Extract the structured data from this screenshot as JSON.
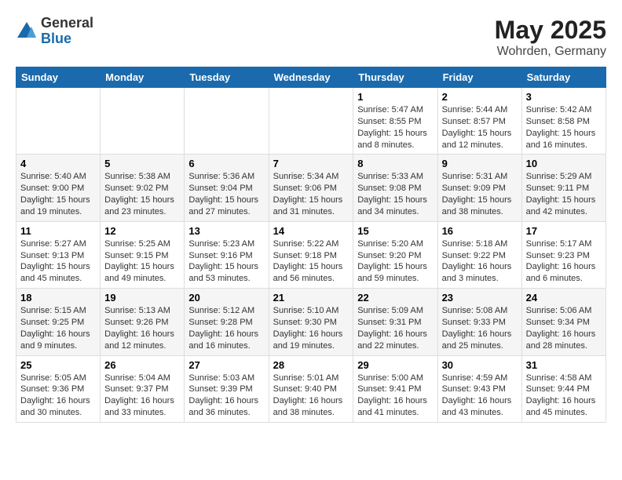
{
  "logo": {
    "general": "General",
    "blue": "Blue"
  },
  "header": {
    "month_year": "May 2025",
    "location": "Wohrden, Germany"
  },
  "weekdays": [
    "Sunday",
    "Monday",
    "Tuesday",
    "Wednesday",
    "Thursday",
    "Friday",
    "Saturday"
  ],
  "weeks": [
    [
      {
        "day": "",
        "info": ""
      },
      {
        "day": "",
        "info": ""
      },
      {
        "day": "",
        "info": ""
      },
      {
        "day": "",
        "info": ""
      },
      {
        "day": "1",
        "info": "Sunrise: 5:47 AM\nSunset: 8:55 PM\nDaylight: 15 hours\nand 8 minutes."
      },
      {
        "day": "2",
        "info": "Sunrise: 5:44 AM\nSunset: 8:57 PM\nDaylight: 15 hours\nand 12 minutes."
      },
      {
        "day": "3",
        "info": "Sunrise: 5:42 AM\nSunset: 8:58 PM\nDaylight: 15 hours\nand 16 minutes."
      }
    ],
    [
      {
        "day": "4",
        "info": "Sunrise: 5:40 AM\nSunset: 9:00 PM\nDaylight: 15 hours\nand 19 minutes."
      },
      {
        "day": "5",
        "info": "Sunrise: 5:38 AM\nSunset: 9:02 PM\nDaylight: 15 hours\nand 23 minutes."
      },
      {
        "day": "6",
        "info": "Sunrise: 5:36 AM\nSunset: 9:04 PM\nDaylight: 15 hours\nand 27 minutes."
      },
      {
        "day": "7",
        "info": "Sunrise: 5:34 AM\nSunset: 9:06 PM\nDaylight: 15 hours\nand 31 minutes."
      },
      {
        "day": "8",
        "info": "Sunrise: 5:33 AM\nSunset: 9:08 PM\nDaylight: 15 hours\nand 34 minutes."
      },
      {
        "day": "9",
        "info": "Sunrise: 5:31 AM\nSunset: 9:09 PM\nDaylight: 15 hours\nand 38 minutes."
      },
      {
        "day": "10",
        "info": "Sunrise: 5:29 AM\nSunset: 9:11 PM\nDaylight: 15 hours\nand 42 minutes."
      }
    ],
    [
      {
        "day": "11",
        "info": "Sunrise: 5:27 AM\nSunset: 9:13 PM\nDaylight: 15 hours\nand 45 minutes."
      },
      {
        "day": "12",
        "info": "Sunrise: 5:25 AM\nSunset: 9:15 PM\nDaylight: 15 hours\nand 49 minutes."
      },
      {
        "day": "13",
        "info": "Sunrise: 5:23 AM\nSunset: 9:16 PM\nDaylight: 15 hours\nand 53 minutes."
      },
      {
        "day": "14",
        "info": "Sunrise: 5:22 AM\nSunset: 9:18 PM\nDaylight: 15 hours\nand 56 minutes."
      },
      {
        "day": "15",
        "info": "Sunrise: 5:20 AM\nSunset: 9:20 PM\nDaylight: 15 hours\nand 59 minutes."
      },
      {
        "day": "16",
        "info": "Sunrise: 5:18 AM\nSunset: 9:22 PM\nDaylight: 16 hours\nand 3 minutes."
      },
      {
        "day": "17",
        "info": "Sunrise: 5:17 AM\nSunset: 9:23 PM\nDaylight: 16 hours\nand 6 minutes."
      }
    ],
    [
      {
        "day": "18",
        "info": "Sunrise: 5:15 AM\nSunset: 9:25 PM\nDaylight: 16 hours\nand 9 minutes."
      },
      {
        "day": "19",
        "info": "Sunrise: 5:13 AM\nSunset: 9:26 PM\nDaylight: 16 hours\nand 12 minutes."
      },
      {
        "day": "20",
        "info": "Sunrise: 5:12 AM\nSunset: 9:28 PM\nDaylight: 16 hours\nand 16 minutes."
      },
      {
        "day": "21",
        "info": "Sunrise: 5:10 AM\nSunset: 9:30 PM\nDaylight: 16 hours\nand 19 minutes."
      },
      {
        "day": "22",
        "info": "Sunrise: 5:09 AM\nSunset: 9:31 PM\nDaylight: 16 hours\nand 22 minutes."
      },
      {
        "day": "23",
        "info": "Sunrise: 5:08 AM\nSunset: 9:33 PM\nDaylight: 16 hours\nand 25 minutes."
      },
      {
        "day": "24",
        "info": "Sunrise: 5:06 AM\nSunset: 9:34 PM\nDaylight: 16 hours\nand 28 minutes."
      }
    ],
    [
      {
        "day": "25",
        "info": "Sunrise: 5:05 AM\nSunset: 9:36 PM\nDaylight: 16 hours\nand 30 minutes."
      },
      {
        "day": "26",
        "info": "Sunrise: 5:04 AM\nSunset: 9:37 PM\nDaylight: 16 hours\nand 33 minutes."
      },
      {
        "day": "27",
        "info": "Sunrise: 5:03 AM\nSunset: 9:39 PM\nDaylight: 16 hours\nand 36 minutes."
      },
      {
        "day": "28",
        "info": "Sunrise: 5:01 AM\nSunset: 9:40 PM\nDaylight: 16 hours\nand 38 minutes."
      },
      {
        "day": "29",
        "info": "Sunrise: 5:00 AM\nSunset: 9:41 PM\nDaylight: 16 hours\nand 41 minutes."
      },
      {
        "day": "30",
        "info": "Sunrise: 4:59 AM\nSunset: 9:43 PM\nDaylight: 16 hours\nand 43 minutes."
      },
      {
        "day": "31",
        "info": "Sunrise: 4:58 AM\nSunset: 9:44 PM\nDaylight: 16 hours\nand 45 minutes."
      }
    ]
  ]
}
